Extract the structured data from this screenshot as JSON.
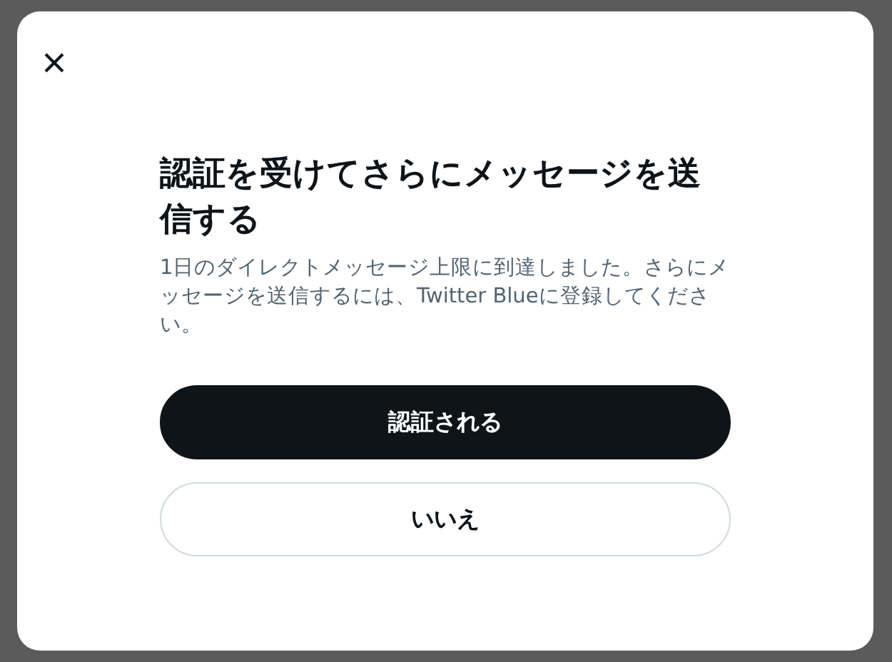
{
  "dialog": {
    "title": "認証を受けてさらにメッセージを送信する",
    "description": "1日のダイレクトメッセージ上限に到達しました。さらにメッセージを送信するには、Twitter Blueに登録してください。",
    "buttons": [
      {
        "label": "認証される",
        "kind": "primary"
      },
      {
        "label": "いいえ",
        "kind": "secondary"
      }
    ]
  }
}
